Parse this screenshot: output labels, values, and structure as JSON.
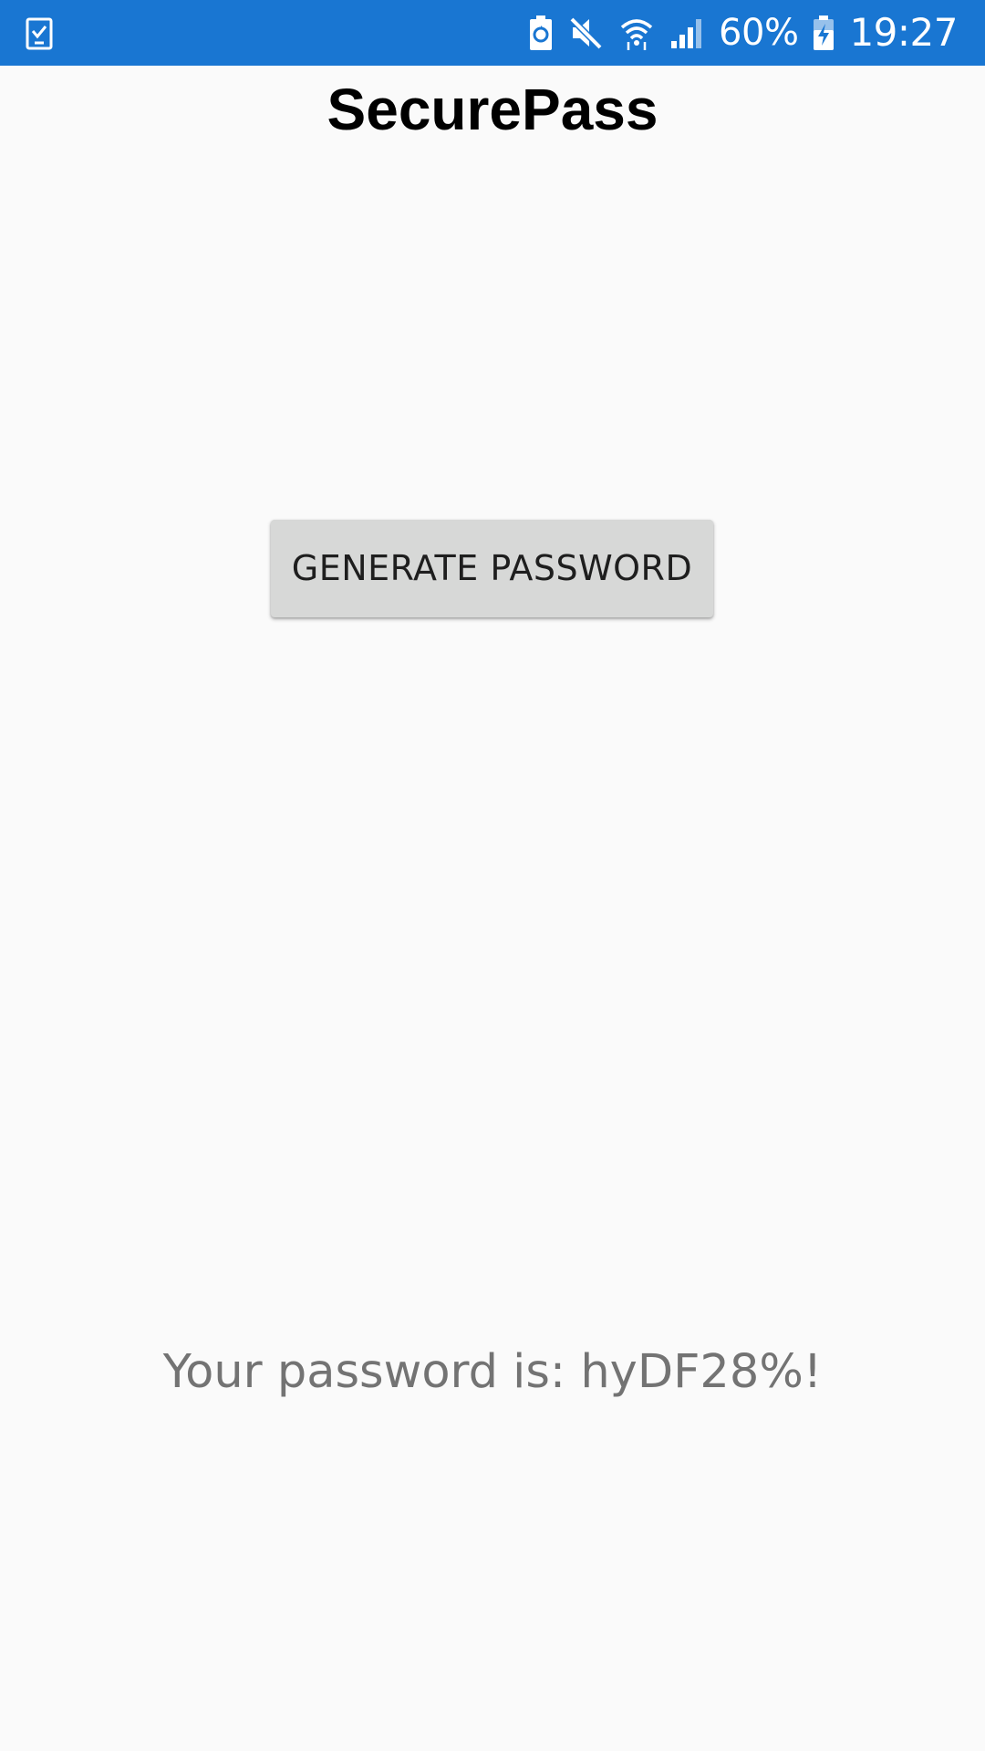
{
  "status_bar": {
    "left_icons": [
      "task-check-icon"
    ],
    "right_icons": [
      "battery-saver-icon",
      "mute-icon",
      "wifi-icon",
      "signal-icon",
      "battery-charging-icon"
    ],
    "battery_percent": "60%",
    "time": "19:27",
    "background_color": "#1976d2"
  },
  "app": {
    "title": "SecurePass"
  },
  "main": {
    "generate_button_label": "GENERATE PASSWORD",
    "password_text": "Your password is: hyDF28%!"
  },
  "colors": {
    "background": "#fafafa",
    "button": "#d7d8d7",
    "output_text": "#737373"
  }
}
